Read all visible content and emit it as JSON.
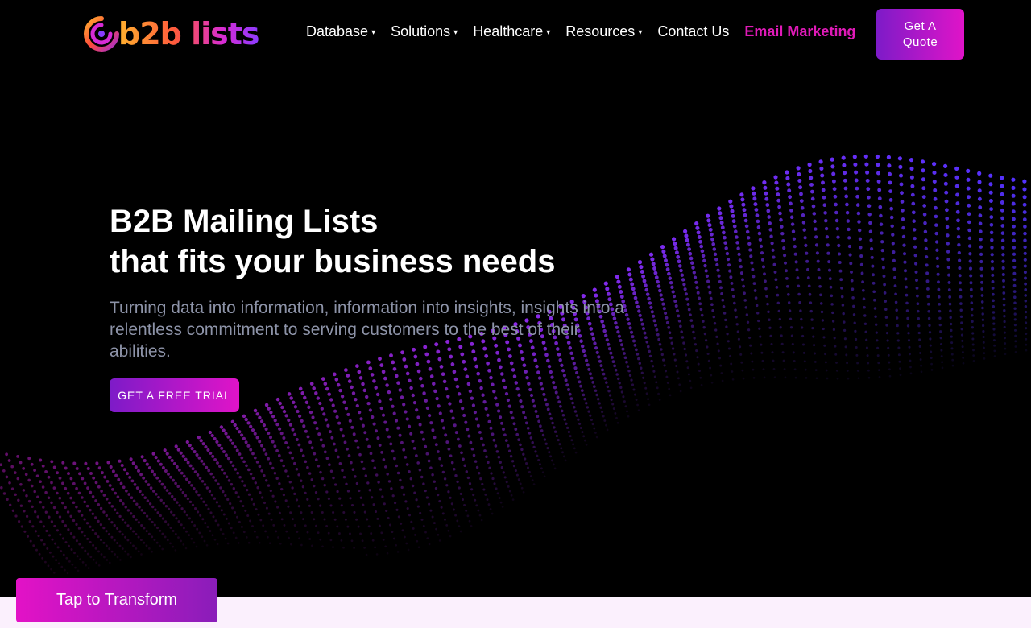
{
  "header": {
    "logo_text": "b2b lists",
    "nav": [
      {
        "label": "Database",
        "has_dropdown": true
      },
      {
        "label": "Solutions",
        "has_dropdown": true
      },
      {
        "label": "Healthcare",
        "has_dropdown": true
      },
      {
        "label": "Resources",
        "has_dropdown": true
      },
      {
        "label": "Contact Us",
        "has_dropdown": false
      },
      {
        "label": "Email Marketing",
        "has_dropdown": false
      }
    ],
    "quote_button": "Get A Quote",
    "caret_icon": "▾"
  },
  "hero": {
    "headline_line1": "B2B Mailing Lists",
    "headline_line2": "that fits your business needs",
    "subtext": "Turning data into information, information into insights, insights into a relentless commitment to serving customers to the best of their abilities.",
    "cta_button": "GET A FREE TRIAL"
  },
  "floating_button": "Tap to Transform",
  "colors": {
    "accent_pink": "#e01ab8",
    "gradient_start": "#7d1bc8",
    "gradient_end": "#e014c8",
    "background": "#000000",
    "subtext": "#8d93a8"
  },
  "icons": {
    "logo": "swirl-logo-icon",
    "dropdown": "caret-down-icon"
  }
}
